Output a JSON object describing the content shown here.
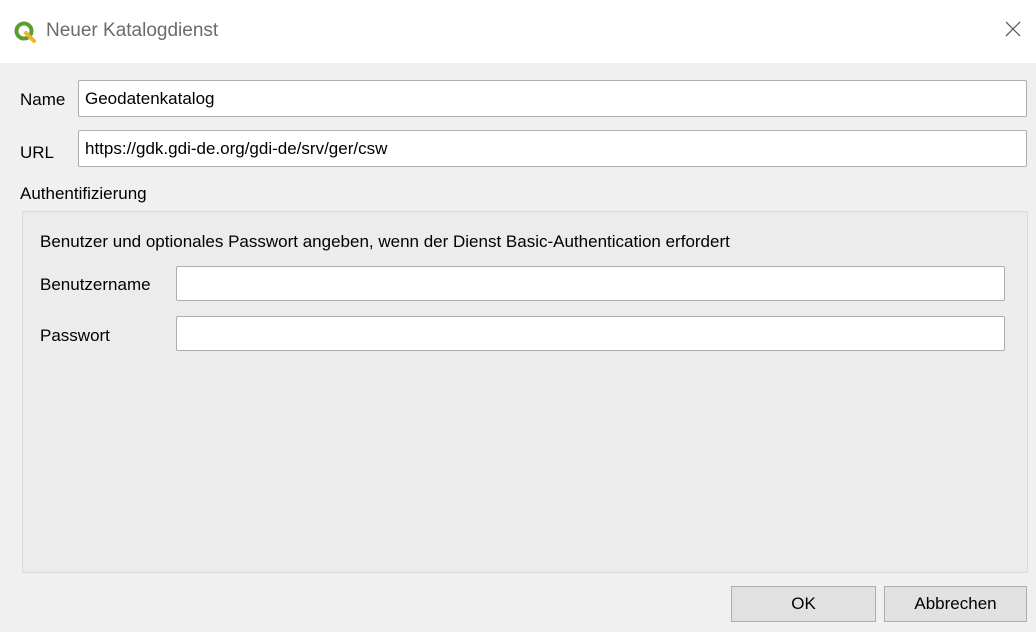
{
  "window": {
    "title": "Neuer Katalogdienst",
    "icon": "qgis-logo-icon",
    "close_icon": "close-icon",
    "accent_color": "#5b9e2e"
  },
  "form": {
    "name_label": "Name",
    "name_value": "Geodatenkatalog",
    "url_label": "URL",
    "url_value": "https://gdk.gdi-de.org/gdi-de/srv/ger/csw"
  },
  "auth": {
    "group_label": "Authentifizierung",
    "hint": "Benutzer und optionales Passwort angeben, wenn der Dienst Basic-Authentication erfordert",
    "username_label": "Benutzername",
    "username_value": "",
    "password_label": "Passwort",
    "password_value": ""
  },
  "buttons": {
    "ok_label": "OK",
    "cancel_label": "Abbrechen"
  }
}
